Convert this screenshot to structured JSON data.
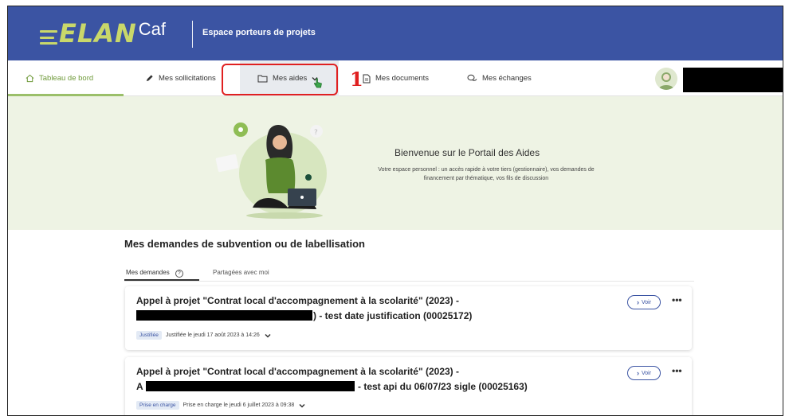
{
  "app": {
    "logo_main": "ELAN",
    "logo_sub": "Caf",
    "header_title": "Espace porteurs de projets"
  },
  "nav": {
    "items": [
      {
        "label": "Tableau de bord",
        "icon": "home-icon"
      },
      {
        "label": "Mes sollicitations",
        "icon": "pen-icon"
      },
      {
        "label": "Mes aides",
        "icon": "folder-icon"
      },
      {
        "label": "Mes documents",
        "icon": "document-icon"
      },
      {
        "label": "Mes échanges",
        "icon": "chat-icon"
      }
    ],
    "active_index": 0
  },
  "annotation": {
    "step": "1"
  },
  "banner": {
    "title": "Bienvenue sur le Portail des Aides",
    "text": "Votre espace personnel : un accès rapide à votre tiers (gestionnaire), vos demandes de financement par thématique, vos fils de discussion"
  },
  "main": {
    "section_title": "Mes demandes de subvention ou de labellisation",
    "tabs": [
      {
        "label": "Mes demandes"
      },
      {
        "label": "Partagées avec moi"
      }
    ],
    "cards": [
      {
        "title_line1": "Appel à projet \"Contrat local d'accompagnement à la scolarité\" (2023) -",
        "title_line2_suffix": ") - test date justification (00025172)",
        "status_badge": "Justifiée",
        "status_text": "Justifiée le jeudi 17 août 2023 à 14:26",
        "voir_label": "Voir",
        "more_label": "•••"
      },
      {
        "title_line1": "Appel à projet \"Contrat local d'accompagnement à la scolarité\" (2023) -",
        "title_line2_prefix": "A",
        "title_line2_suffix": "- test api du 06/07/23 sigle (00025163)",
        "status_badge": "Prise en charge",
        "status_text": "Prise en charge le jeudi 6 juillet 2023 à 09:38",
        "voir_label": "Voir",
        "more_label": "•••"
      }
    ]
  },
  "colors": {
    "header_bg": "#3b54a3",
    "logo_accent": "#c9d86a",
    "active_nav": "#6f9a3a",
    "banner_bg": "#eef3e4",
    "annotation_red": "#e02020"
  }
}
